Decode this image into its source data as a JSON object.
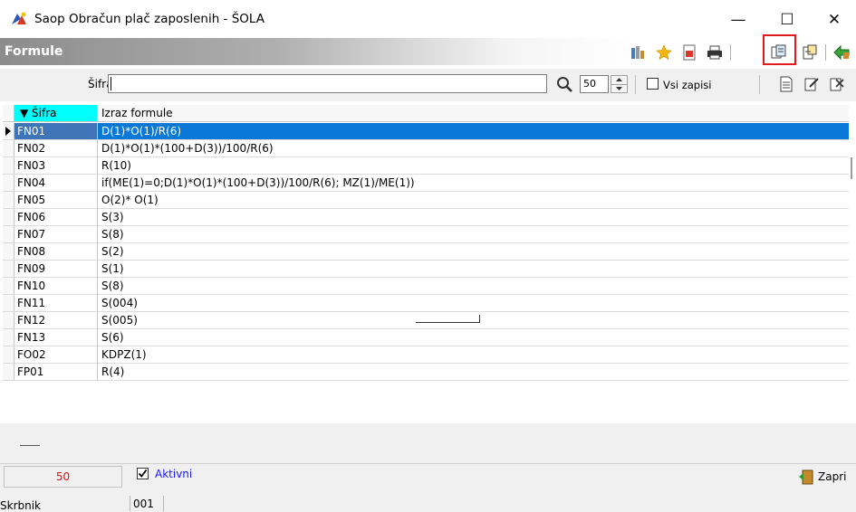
{
  "window": {
    "title": "Saop Obračun plač zaposlenih - ŠOLA",
    "controls": {
      "minimize": "—",
      "maximize": "☐",
      "close": "✕"
    }
  },
  "panel": {
    "title": "Formule",
    "toolbar_icons": [
      "filter-icon",
      "favorite-star-icon",
      "export-icon",
      "print-icon",
      "copy-icon",
      "paste-icon",
      "exit-icon"
    ],
    "highlighted_icon": "copy-icon",
    "highlight_color": "#e01a1a"
  },
  "search": {
    "label": "Šifra",
    "value": "",
    "count": "50",
    "all_records_label": "Vsi zapisi",
    "all_records_checked": false
  },
  "grid": {
    "columns": [
      {
        "key": "code",
        "label": "▼ Šifra"
      },
      {
        "key": "expression",
        "label": "Izraz formule"
      }
    ],
    "rows": [
      {
        "code": "FN01",
        "expression": "D(1)*O(1)/R(6)"
      },
      {
        "code": "FN02",
        "expression": "D(1)*O(1)*(100+D(3))/100/R(6)"
      },
      {
        "code": "FN03",
        "expression": "R(10)"
      },
      {
        "code": "FN04",
        "expression": "if(ME(1)=0;D(1)*O(1)*(100+D(3))/100/R(6); MZ(1)/ME(1))"
      },
      {
        "code": "FN05",
        "expression": "O(2)* O(1)"
      },
      {
        "code": "FN06",
        "expression": "S(3)"
      },
      {
        "code": "FN07",
        "expression": "S(8)"
      },
      {
        "code": "FN08",
        "expression": "S(2)"
      },
      {
        "code": "FN09",
        "expression": "S(1)"
      },
      {
        "code": "FN10",
        "expression": "S(8)"
      },
      {
        "code": "FN11",
        "expression": "S(004)"
      },
      {
        "code": "FN12",
        "expression": "S(005)"
      },
      {
        "code": "FN13",
        "expression": "S(6)"
      },
      {
        "code": "FO02",
        "expression": "KDPZ(1)"
      },
      {
        "code": "FP01",
        "expression": "R(4)"
      }
    ],
    "selected_row": "FN01",
    "header_color": "#00ffff",
    "selection_color": "#0a78d7"
  },
  "footer": {
    "record_count": "50",
    "active_label": "Aktivni",
    "active_checked": true,
    "close_label": "Zapri"
  },
  "status": {
    "user": "Skrbnik",
    "code": "001"
  }
}
